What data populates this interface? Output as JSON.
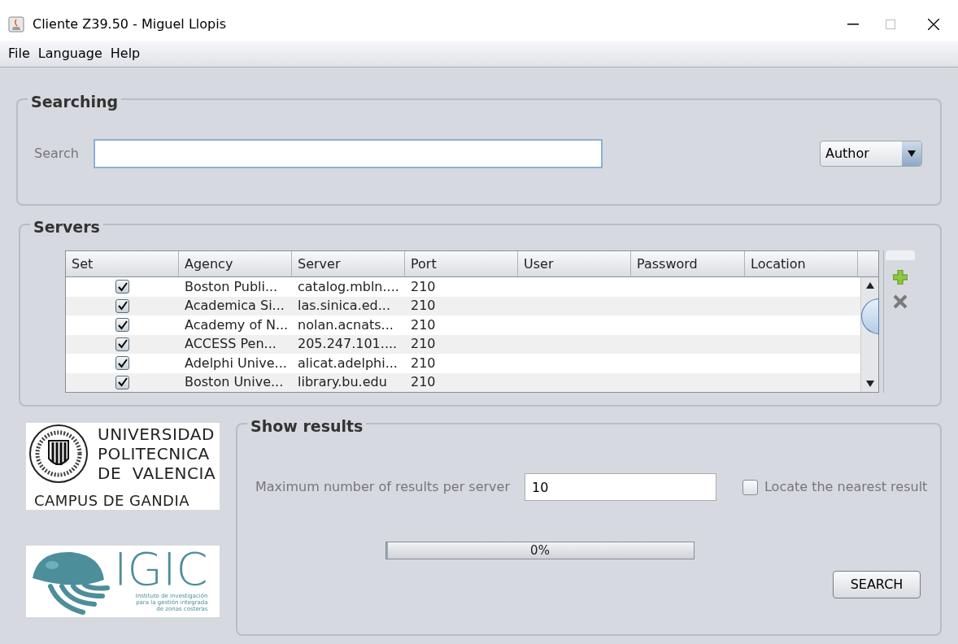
{
  "window": {
    "title": "Cliente Z39.50 - Miguel Llopis"
  },
  "menu": [
    "File",
    "Language",
    "Help"
  ],
  "searching": {
    "title": "Searching",
    "label": "Search",
    "field": "Author"
  },
  "servers": {
    "title": "Servers",
    "columns": [
      "Set",
      "Agency",
      "Server",
      "Port",
      "User",
      "Password",
      "Location"
    ],
    "rows": [
      {
        "checked": true,
        "agency": "Boston Publi...",
        "server": "catalog.mbln....",
        "port": "210"
      },
      {
        "checked": true,
        "agency": "Academica Si...",
        "server": "las.sinica.ed...",
        "port": "210"
      },
      {
        "checked": true,
        "agency": "Academy of N...",
        "server": "nolan.acnats...",
        "port": "210"
      },
      {
        "checked": true,
        "agency": "ACCESS Pen...",
        "server": "205.247.101....",
        "port": "210"
      },
      {
        "checked": true,
        "agency": "Adelphi Unive...",
        "server": "alicat.adelphi...",
        "port": "210"
      },
      {
        "checked": true,
        "agency": "Boston Unive...",
        "server": "library.bu.edu",
        "port": "210"
      }
    ]
  },
  "logos": {
    "upv": [
      "UNIVERSIDAD",
      "POLITECNICA",
      "DE  VALENCIA"
    ],
    "campus": "CAMPUS DE GANDIA",
    "igic": "IGIC",
    "igic_sub": [
      "Instituto de investigación",
      "para la gestión integrada",
      "de zonas costeras"
    ]
  },
  "results": {
    "title": "Show results",
    "max_label": "Maximum number of results per server",
    "max_value": "10",
    "locate": {
      "label": "Locate the nearest result",
      "checked": false
    },
    "progress": {
      "level": 0,
      "text": "0%"
    },
    "button": "SEARCH"
  }
}
